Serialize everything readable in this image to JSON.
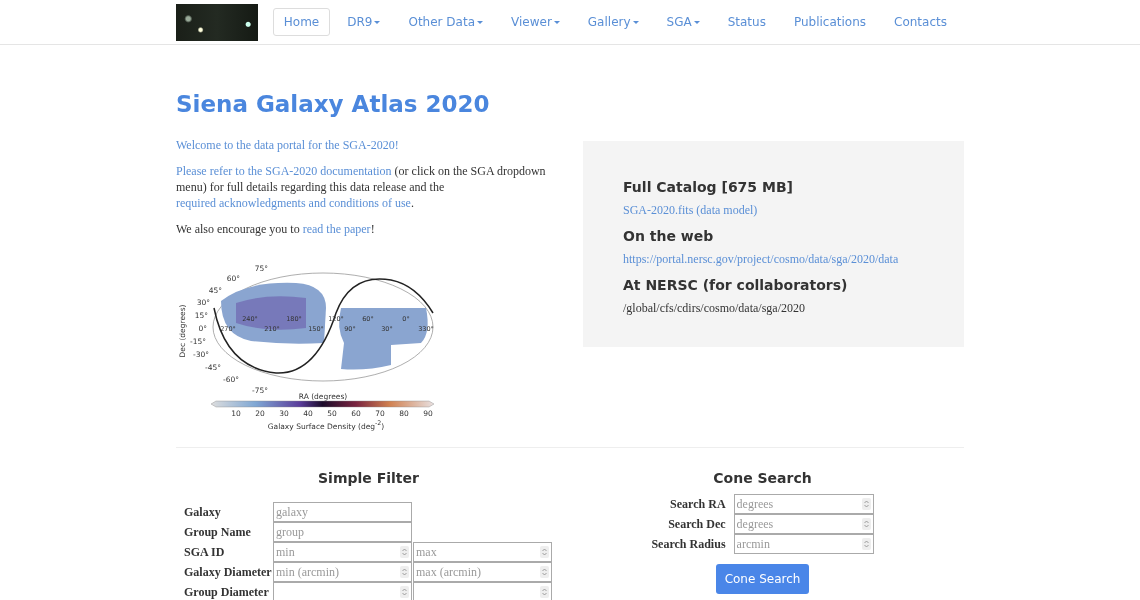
{
  "nav": [
    {
      "label": "Home",
      "selected": true,
      "dropdown": false
    },
    {
      "label": "DR9",
      "selected": false,
      "dropdown": true
    },
    {
      "label": "Other Data",
      "selected": false,
      "dropdown": true
    },
    {
      "label": "Viewer",
      "selected": false,
      "dropdown": true
    },
    {
      "label": "Gallery",
      "selected": false,
      "dropdown": true
    },
    {
      "label": "SGA",
      "selected": false,
      "dropdown": true
    },
    {
      "label": "Status",
      "selected": false,
      "dropdown": false
    },
    {
      "label": "Publications",
      "selected": false,
      "dropdown": false
    },
    {
      "label": "Contacts",
      "selected": false,
      "dropdown": false
    }
  ],
  "title": "Siena Galaxy Atlas 2020",
  "intro": [
    [
      {
        "text": "Welcome to the data portal for the SGA-2020!",
        "link": true
      }
    ],
    [
      {
        "text": "Please refer to the SGA-2020 documentation",
        "link": true
      },
      {
        "text": " (or click on the SGA dropdown menu) for full details regarding this data release and the ",
        "link": false
      },
      {
        "text": "required acknowledgments and conditions of use",
        "link": true
      },
      {
        "text": ".",
        "link": false
      }
    ],
    [
      {
        "text": "We also encourage you to ",
        "link": false
      },
      {
        "text": "read the paper",
        "link": true
      },
      {
        "text": "!",
        "link": false
      }
    ]
  ],
  "sky_map": {
    "dec_label": "Dec (degrees)",
    "ra_label": "RA (degrees)",
    "dec_ticks": [
      "75°",
      "60°",
      "45°",
      "30°",
      "15°",
      "0°",
      "-15°",
      "-30°",
      "-45°",
      "-60°",
      "-75°"
    ],
    "ra_ticks": [
      "270°",
      "240°",
      "210°",
      "180°",
      "150°",
      "120°",
      "90°",
      "60°",
      "30°",
      "0°",
      "330°"
    ],
    "colorbar_ticks": [
      "10",
      "20",
      "30",
      "40",
      "50",
      "60",
      "70",
      "80",
      "90"
    ],
    "colorbar_label": "Galaxy Surface Density (deg$^{-2}$)"
  },
  "downloads": [
    {
      "heading": "Full Catalog [675 MB]",
      "value": "SGA-2020.fits (data model)",
      "link": true
    },
    {
      "heading": "On the web",
      "value": "https://portal.nersc.gov/project/cosmo/data/sga/2020/data",
      "link": true
    },
    {
      "heading": "At NERSC (for collaborators)",
      "value": "/global/cfs/cdirs/cosmo/data/sga/2020",
      "link": false
    }
  ],
  "simple_filter": {
    "title": "Simple Filter",
    "rows": [
      {
        "label": "Galaxy",
        "fields": [
          {
            "kind": "text",
            "placeholder": "galaxy"
          }
        ]
      },
      {
        "label": "Group Name",
        "fields": [
          {
            "kind": "text",
            "placeholder": "group"
          }
        ]
      },
      {
        "label": "SGA ID",
        "fields": [
          {
            "kind": "number",
            "placeholder": "min"
          },
          {
            "kind": "number",
            "placeholder": "max"
          }
        ]
      },
      {
        "label": "Galaxy Diameter",
        "fields": [
          {
            "kind": "number",
            "placeholder": "min (arcmin)"
          },
          {
            "kind": "number",
            "placeholder": "max (arcmin)"
          }
        ]
      },
      {
        "label": "Group Diameter",
        "fields": [
          {
            "kind": "number"
          },
          {
            "kind": "number"
          }
        ]
      }
    ]
  },
  "cone_search": {
    "title": "Cone Search",
    "rows": [
      {
        "label": "Search RA",
        "placeholder": "degrees"
      },
      {
        "label": "Search Dec",
        "placeholder": "degrees"
      },
      {
        "label": "Search Radius",
        "placeholder": "arcmin"
      }
    ],
    "button": "Cone Search"
  }
}
